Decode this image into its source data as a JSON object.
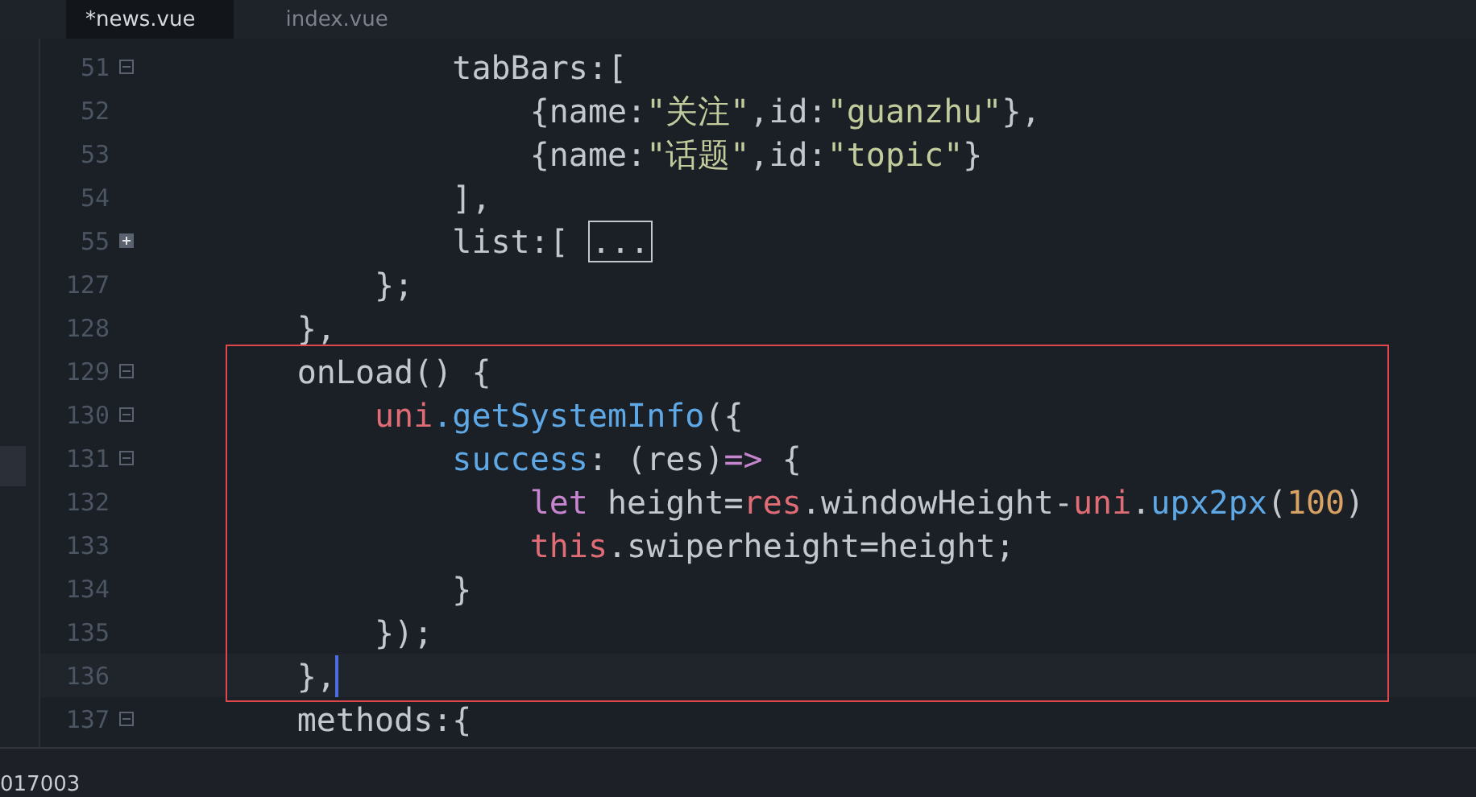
{
  "tabs": [
    {
      "label": "*news.vue",
      "selected": true
    },
    {
      "label": "index.vue",
      "selected": false
    }
  ],
  "blocks": [
    {
      "boxed": false,
      "lines": [
        {
          "number": "51",
          "kind": "collapsible",
          "current": false,
          "tokens": [
            {
              "kind": "plain",
              "text": "                tabBars:["
            }
          ]
        },
        {
          "number": "52",
          "kind": "plain",
          "current": false,
          "tokens": [
            {
              "kind": "plain",
              "text": "                    {name:"
            },
            {
              "kind": "string",
              "text": "\"关注\""
            },
            {
              "kind": "plain",
              "text": ",id:"
            },
            {
              "kind": "string",
              "text": "\"guanzhu\""
            },
            {
              "kind": "plain",
              "text": "},"
            }
          ]
        },
        {
          "number": "53",
          "kind": "plain",
          "current": false,
          "tokens": [
            {
              "kind": "plain",
              "text": "                    {name:"
            },
            {
              "kind": "string",
              "text": "\"话题\""
            },
            {
              "kind": "plain",
              "text": ",id:"
            },
            {
              "kind": "string",
              "text": "\"topic\""
            },
            {
              "kind": "plain",
              "text": "}"
            }
          ]
        },
        {
          "number": "54",
          "kind": "plain",
          "current": false,
          "tokens": [
            {
              "kind": "plain",
              "text": "                ],"
            }
          ]
        },
        {
          "number": "55",
          "kind": "collapsed",
          "current": false,
          "tokens": [
            {
              "kind": "plain",
              "text": "                list:[ "
            },
            {
              "kind": "placeholder",
              "text": "..."
            }
          ]
        },
        {
          "number": "127",
          "kind": "plain",
          "current": false,
          "tokens": [
            {
              "kind": "plain",
              "text": "            };"
            }
          ]
        },
        {
          "number": "128",
          "kind": "plain",
          "current": false,
          "tokens": [
            {
              "kind": "plain",
              "text": "        },"
            }
          ]
        }
      ]
    },
    {
      "boxed": true,
      "lines": [
        {
          "number": "129",
          "kind": "collapsible",
          "current": false,
          "tokens": [
            {
              "kind": "plain",
              "text": "        onLoad() {"
            }
          ]
        },
        {
          "number": "130",
          "kind": "collapsible",
          "current": false,
          "tokens": [
            {
              "kind": "object",
              "text": "            uni"
            },
            {
              "kind": "method",
              "text": ".getSystemInfo"
            },
            {
              "kind": "plain",
              "text": "({"
            }
          ]
        },
        {
          "number": "131",
          "kind": "collapsible",
          "current": false,
          "tokens": [
            {
              "kind": "method",
              "text": "                success"
            },
            {
              "kind": "plain",
              "text": ": (res)"
            },
            {
              "kind": "keyword",
              "text": "=>"
            },
            {
              "kind": "plain",
              "text": " {"
            }
          ]
        },
        {
          "number": "132",
          "kind": "plain",
          "current": false,
          "tokens": [
            {
              "kind": "keyword",
              "text": "                    let"
            },
            {
              "kind": "plain",
              "text": " height="
            },
            {
              "kind": "object",
              "text": "res"
            },
            {
              "kind": "plain",
              "text": ".windowHeight-"
            },
            {
              "kind": "object",
              "text": "uni"
            },
            {
              "kind": "plain",
              "text": "."
            },
            {
              "kind": "method",
              "text": "upx2px"
            },
            {
              "kind": "plain",
              "text": "("
            },
            {
              "kind": "number",
              "text": "100"
            },
            {
              "kind": "plain",
              "text": ")"
            }
          ]
        },
        {
          "number": "133",
          "kind": "plain",
          "current": false,
          "tokens": [
            {
              "kind": "object",
              "text": "                    this"
            },
            {
              "kind": "plain",
              "text": ".swiperheight=height;"
            }
          ]
        },
        {
          "number": "134",
          "kind": "plain",
          "current": false,
          "tokens": [
            {
              "kind": "plain",
              "text": "                }"
            }
          ]
        },
        {
          "number": "135",
          "kind": "plain",
          "current": false,
          "tokens": [
            {
              "kind": "plain",
              "text": "            });"
            }
          ]
        },
        {
          "number": "136",
          "kind": "plain",
          "current": true,
          "tokens": [
            {
              "kind": "plain",
              "text": "        },"
            }
          ]
        }
      ]
    },
    {
      "boxed": false,
      "lines": [
        {
          "number": "137",
          "kind": "collapsible",
          "current": false,
          "tokens": [
            {
              "kind": "plain",
              "text": "        methods:{"
            }
          ]
        }
      ]
    }
  ],
  "status_bar": {
    "text": "017003"
  }
}
